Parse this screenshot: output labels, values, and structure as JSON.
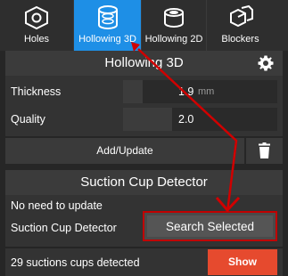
{
  "tabs": [
    {
      "label": "Holes",
      "icon": "holes-icon",
      "active": false
    },
    {
      "label": "Hollowing 3D",
      "icon": "hollowing-3d-icon",
      "active": true
    },
    {
      "label": "Hollowing 2D",
      "icon": "hollowing-2d-icon",
      "active": false
    },
    {
      "label": "Blockers",
      "icon": "blockers-icon",
      "active": false
    }
  ],
  "hollowing": {
    "title": "Hollowing 3D",
    "thickness_label": "Thickness",
    "thickness_value": "1.9",
    "thickness_unit": "mm",
    "quality_label": "Quality",
    "quality_value": "2.0",
    "add_update_label": "Add/Update"
  },
  "suction": {
    "title": "Suction Cup Detector",
    "status_text": "No need to update",
    "detector_label": "Suction Cup Detector",
    "search_button": "Search Selected",
    "detected_text": "29 suctions cups detected",
    "show_button": "Show"
  },
  "colors": {
    "accent": "#1e8fe6",
    "show_button": "#e64a2e",
    "highlight": "#c00000"
  }
}
